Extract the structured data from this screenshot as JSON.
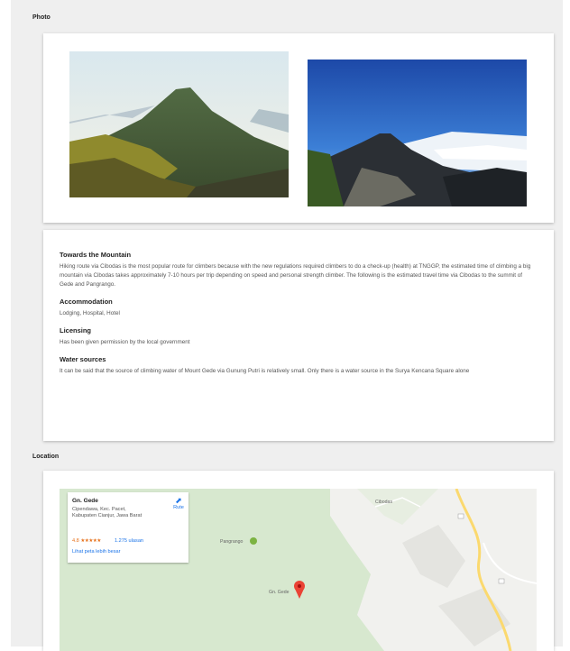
{
  "sections": {
    "photo_title": "Photo",
    "location_title": "Location"
  },
  "photos": [
    {
      "alt": "Mount Gede seen from a ridge with green slopes"
    },
    {
      "alt": "Mount Gede above a sea of clouds under a blue sky"
    }
  ],
  "info": {
    "towards": {
      "heading": "Towards the Mountain",
      "body": "Hiking route via Cibodas is the most popular route for climbers because with the new regulations required climbers to do a check-up (health) at TNGGP, the estimated time of climbing a big mountain via Cibodas takes approximately 7-10 hours per trip depending on speed and personal strength climber. The following is the estimated travel time via Cibodas to the summit of Gede and Pangrango."
    },
    "accommodation": {
      "heading": "Accommodation",
      "body": "Lodging, Hospital, Hotel"
    },
    "licensing": {
      "heading": "Licensing",
      "body": "Has been given permission by the local government"
    },
    "water": {
      "heading": "Water sources",
      "body": "It can be said that the source of climbing water of Mount Gede via Gunung Putri is relatively small. Only there is a water source in the Surya Kencana Square alone"
    }
  },
  "map": {
    "place_name": "Gn. Gede",
    "address": "Cipendawa, Kec. Pacet, Kabupaten Cianjur, Jawa Barat",
    "rating": "4.8",
    "stars": "★★★★★",
    "reviews": "1.275 ulasan",
    "larger_map": "Lihat peta lebih besar",
    "route_label": "Rute",
    "route_icon": "directions-icon",
    "label_pangrango": "Pangrango",
    "label_gede": "Gn. Gede",
    "label_cibodas": "Cibodas",
    "colors": {
      "land": "#d7e8cf",
      "terrain": "#f2f2f2",
      "road": "#fbd96e",
      "pin": "#ea4335",
      "poi": "#7cb342"
    }
  }
}
